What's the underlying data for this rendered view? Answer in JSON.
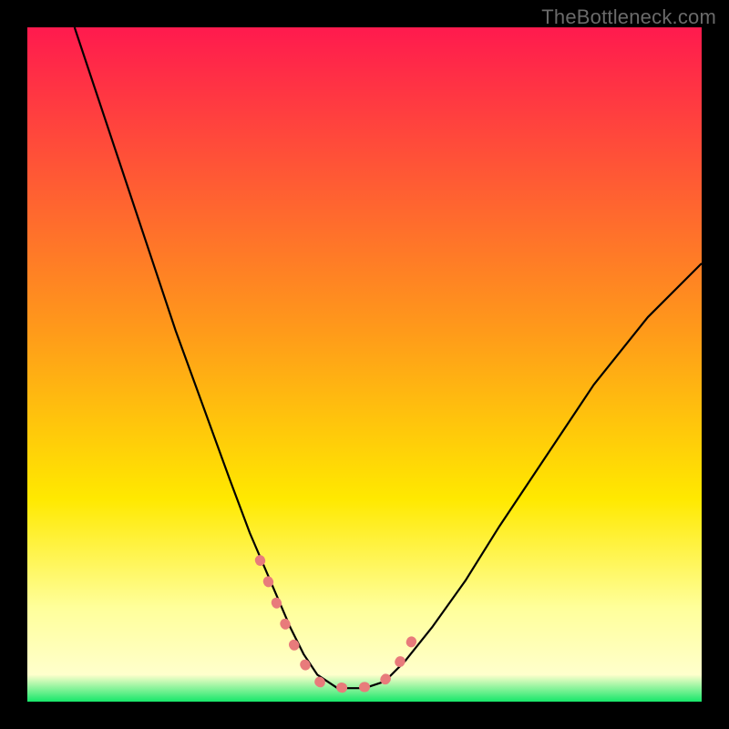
{
  "watermark": {
    "text": "TheBottleneck.com"
  },
  "chart_data": {
    "type": "line",
    "title": "",
    "xlabel": "",
    "ylabel": "",
    "xlim": [
      0,
      1
    ],
    "ylim": [
      0,
      1
    ],
    "background_gradient": {
      "stops": [
        {
          "offset": 0.0,
          "color": "#ff1a4e"
        },
        {
          "offset": 0.45,
          "color": "#ff9a1a"
        },
        {
          "offset": 0.7,
          "color": "#ffe900"
        },
        {
          "offset": 0.86,
          "color": "#ffff9a"
        },
        {
          "offset": 0.96,
          "color": "#ffffcc"
        },
        {
          "offset": 1.0,
          "color": "#17e76a"
        }
      ]
    },
    "series": [
      {
        "name": "bottleneck-curve",
        "color": "#000000",
        "width": 2.2,
        "x": [
          0.07,
          0.1,
          0.14,
          0.18,
          0.22,
          0.26,
          0.3,
          0.33,
          0.36,
          0.39,
          0.41,
          0.43,
          0.46,
          0.5,
          0.53,
          0.56,
          0.6,
          0.65,
          0.7,
          0.76,
          0.84,
          0.92,
          1.0
        ],
        "values": [
          1.0,
          0.91,
          0.79,
          0.67,
          0.55,
          0.44,
          0.33,
          0.25,
          0.18,
          0.11,
          0.07,
          0.04,
          0.02,
          0.02,
          0.03,
          0.06,
          0.11,
          0.18,
          0.26,
          0.35,
          0.47,
          0.57,
          0.65
        ]
      },
      {
        "name": "highlight-overlay",
        "color": "#e87b7b",
        "width": 11,
        "linecap": "round",
        "dash": "1 24",
        "x": [
          0.345,
          0.37,
          0.395,
          0.418,
          0.435,
          0.47,
          0.505,
          0.53,
          0.55,
          0.567,
          0.582
        ],
        "values": [
          0.21,
          0.145,
          0.085,
          0.044,
          0.028,
          0.02,
          0.022,
          0.032,
          0.055,
          0.083,
          0.118
        ]
      }
    ]
  }
}
